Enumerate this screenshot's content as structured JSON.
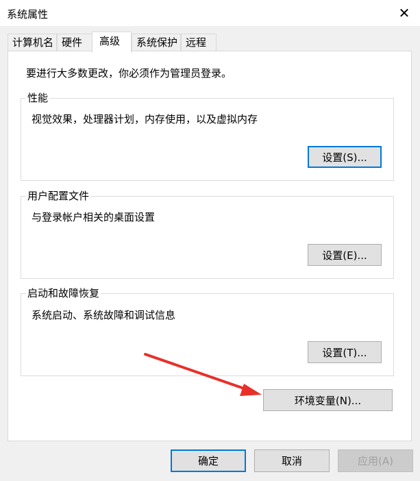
{
  "window": {
    "title": "系统属性",
    "close_glyph": "✕"
  },
  "tabs": [
    {
      "label": "计算机名"
    },
    {
      "label": "硬件"
    },
    {
      "label": "高级",
      "active": true
    },
    {
      "label": "系统保护"
    },
    {
      "label": "远程"
    }
  ],
  "intro_text": "要进行大多数更改，你必须作为管理员登录。",
  "groups": [
    {
      "title": "性能",
      "description": "视觉效果，处理器计划，内存使用，以及虚拟内存",
      "button": "设置(S)..."
    },
    {
      "title": "用户配置文件",
      "description": "与登录帐户相关的桌面设置",
      "button": "设置(E)..."
    },
    {
      "title": "启动和故障恢复",
      "description": "系统启动、系统故障和调试信息",
      "button": "设置(T)..."
    }
  ],
  "env_button": "环境变量(N)...",
  "footer": {
    "ok": "确定",
    "cancel": "取消",
    "apply": "应用(A)"
  },
  "colors": {
    "accent_border": "#0078d7",
    "annotation_arrow": "#e8302a"
  }
}
